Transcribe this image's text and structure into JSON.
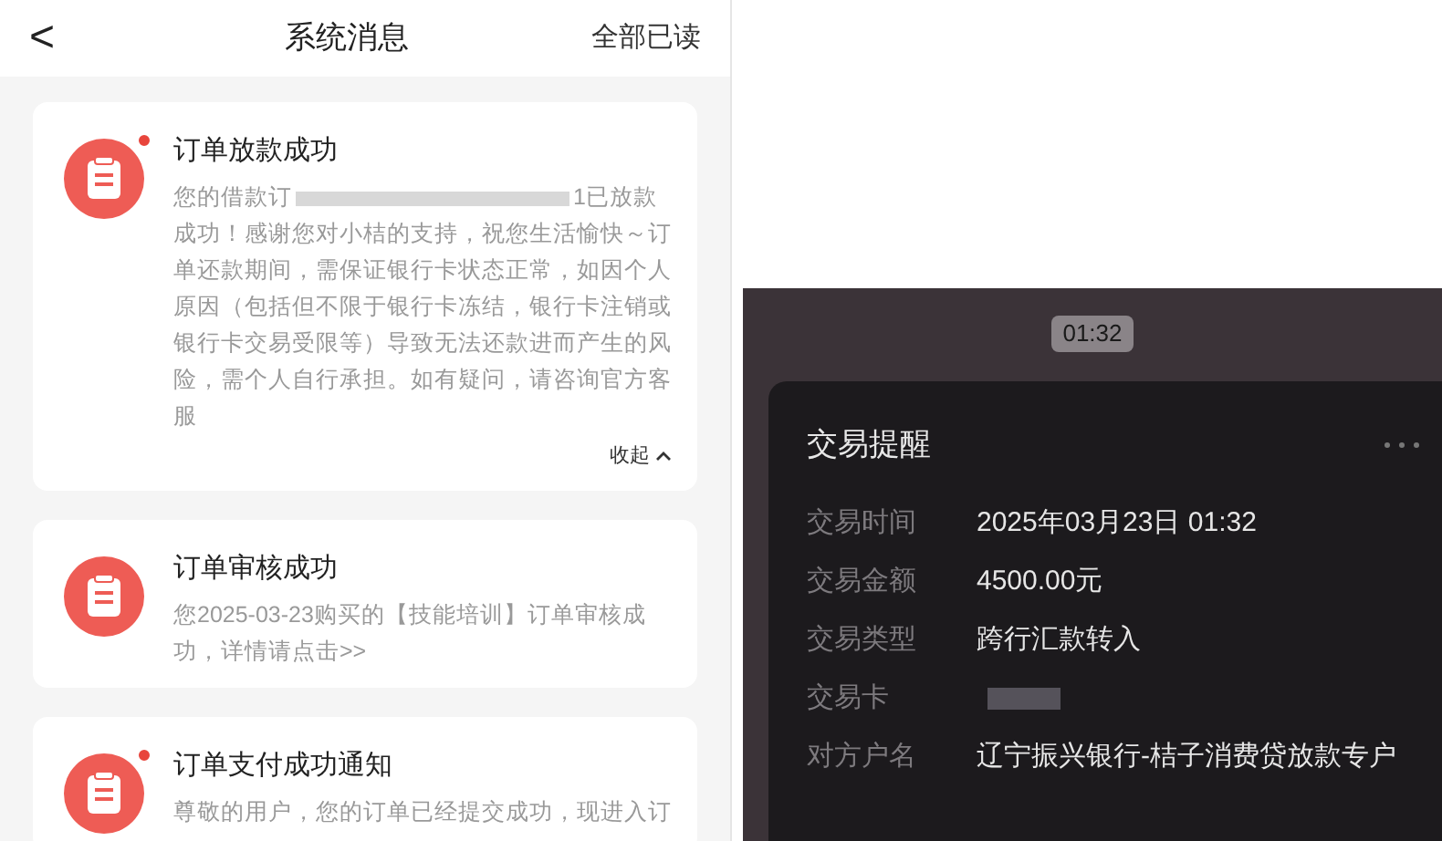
{
  "header": {
    "back": "<",
    "title": "系统消息",
    "action": "全部已读"
  },
  "messages": [
    {
      "title": "订单放款成功",
      "unread": true,
      "body_parts": [
        "您的借款订",
        "1已放款成功！感谢您对小桔的支持，祝您生活愉快～订单还款期间，需保证银行卡状态正常，如因个人原因（包括但不限于银行卡冻结，银行卡注销或银行卡交易受限等）导致无法还款进而产生的风险，需个人自行承担。如有疑问，请咨询官方客服"
      ],
      "expanded": true,
      "toggle": "收起"
    },
    {
      "title": "订单审核成功",
      "unread": false,
      "body_parts": [
        "您2025-03-23购买的【技能培训】订单审核成功，详情请点击>>"
      ],
      "expanded": false
    },
    {
      "title": "订单支付成功通知",
      "unread": true,
      "body_parts": [
        "尊敬的用户，您的订单已经提交成功，现进入订"
      ],
      "expanded": false
    }
  ],
  "chat": {
    "timestamp": "01:32",
    "card": {
      "title": "交易提醒",
      "rows": [
        {
          "kind": "text",
          "label": "交易时间",
          "value": "2025年03月23日 01:32"
        },
        {
          "kind": "text",
          "label": "交易金额",
          "value": "4500.00元"
        },
        {
          "kind": "text",
          "label": "交易类型",
          "value": "跨行汇款转入"
        },
        {
          "kind": "redacted",
          "label": "交易卡"
        },
        {
          "kind": "text",
          "label": "对方户名",
          "value": "辽宁振兴银行-桔子消费贷放款专户"
        }
      ]
    }
  }
}
